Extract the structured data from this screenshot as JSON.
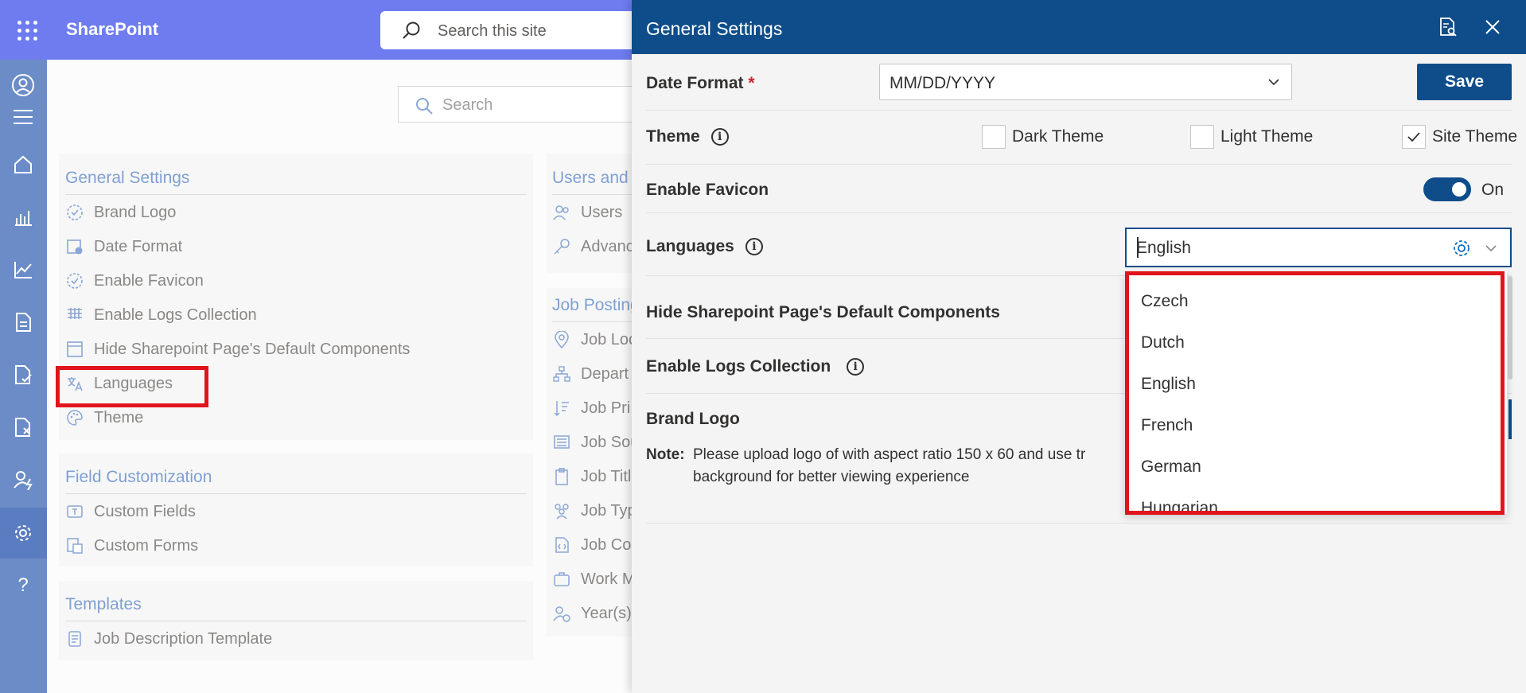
{
  "topbar": {
    "app_name": "SharePoint",
    "search_placeholder": "Search this site"
  },
  "main": {
    "search_placeholder": "Search",
    "general_settings": {
      "title": "General Settings",
      "items": [
        {
          "label": "Brand Logo",
          "icon": "badge-icon"
        },
        {
          "label": "Date Format",
          "icon": "calendar-icon"
        },
        {
          "label": "Enable Favicon",
          "icon": "badge-icon"
        },
        {
          "label": "Enable Logs Collection",
          "icon": "grid-icon"
        },
        {
          "label": "Hide Sharepoint Page's Default Components",
          "icon": "window-icon"
        },
        {
          "label": "Languages",
          "icon": "translate-icon"
        },
        {
          "label": "Theme",
          "icon": "palette-icon"
        }
      ]
    },
    "field_customization": {
      "title": "Field Customization",
      "items": [
        {
          "label": "Custom Fields",
          "icon": "text-box-icon"
        },
        {
          "label": "Custom Forms",
          "icon": "form-icon"
        }
      ]
    },
    "templates": {
      "title": "Templates",
      "items": [
        {
          "label": "Job Description Template",
          "icon": "document-icon"
        }
      ]
    },
    "users_and": {
      "title": "Users and",
      "items": [
        {
          "label": "Users",
          "icon": "users-icon"
        },
        {
          "label": "Advanc",
          "icon": "key-icon"
        }
      ]
    },
    "job_posting": {
      "title": "Job Posting",
      "items": [
        {
          "label": "Job Loc",
          "icon": "location-icon"
        },
        {
          "label": "Depart",
          "icon": "org-chart-icon"
        },
        {
          "label": "Job Pri",
          "icon": "sort-icon"
        },
        {
          "label": "Job Sou",
          "icon": "list-icon"
        },
        {
          "label": "Job Titl",
          "icon": "clipboard-icon"
        },
        {
          "label": "Job Typ",
          "icon": "people-icon"
        },
        {
          "label": "Job Co",
          "icon": "code-doc-icon"
        },
        {
          "label": "Work M",
          "icon": "briefcase-icon"
        },
        {
          "label": "Year(s)",
          "icon": "person-clock-icon"
        }
      ]
    }
  },
  "panel": {
    "title": "General Settings",
    "date_format": {
      "label": "Date Format",
      "required_mark": "*",
      "value": "MM/DD/YYYY"
    },
    "save_label": "Save",
    "theme": {
      "label": "Theme",
      "options": [
        {
          "label": "Dark Theme",
          "checked": false
        },
        {
          "label": "Light Theme",
          "checked": false
        },
        {
          "label": "Site Theme",
          "checked": true
        }
      ]
    },
    "favicon": {
      "label": "Enable Favicon",
      "state_label": "On",
      "on": true
    },
    "languages": {
      "label": "Languages",
      "value": "English",
      "options": [
        "Czech",
        "Dutch",
        "English",
        "French",
        "German",
        "Hungarian"
      ]
    },
    "hide_components": {
      "label": "Hide Sharepoint Page's Default Components"
    },
    "logs": {
      "label": "Enable Logs Collection"
    },
    "brand_logo": {
      "label": "Brand Logo",
      "note_prefix": "Note:",
      "note_line1": "Please upload logo of with aspect ratio 150 x 60 and use tr",
      "note_line2": "background for better viewing experience"
    }
  },
  "colors": {
    "topbar": "#6e7cf0",
    "rail": "#6b8cc7",
    "panel_header": "#0e4d8a",
    "highlight": "#e0141b"
  }
}
